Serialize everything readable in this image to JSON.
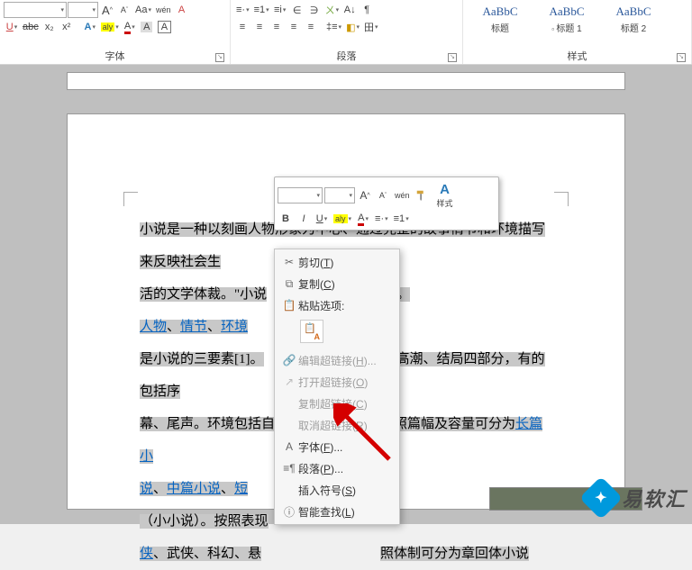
{
  "ribbon": {
    "font": {
      "label": "字体",
      "font_name": "",
      "font_size": "",
      "grow": "A",
      "shrink": "A",
      "change_case": "Aa",
      "phonetic": "wén",
      "clear_fmt": "A",
      "underline": "U",
      "strike": "abc",
      "sub": "x₂",
      "sup": "x²",
      "effects": "A",
      "highlight": "aly",
      "font_color": "A",
      "char_shade": "A",
      "char_border": "A"
    },
    "para": {
      "label": "段落",
      "bullets": "•",
      "numbering": "1",
      "multilevel": "i",
      "dec_indent": "←",
      "inc_indent": "→",
      "sort_cn": "ㄨ",
      "sort": "A↓",
      "show_marks": "¶",
      "align_l": "≡",
      "align_c": "≡",
      "align_r": "≡",
      "justify": "≡",
      "distrib": "≡",
      "line_sp": "↕",
      "shade": "◧",
      "border": "田"
    },
    "styles": {
      "label": "样式",
      "items": [
        {
          "preview": "AaBbC",
          "name": "标题"
        },
        {
          "preview": "AaBbC",
          "name": "标题 1"
        },
        {
          "preview": "AaBbC",
          "name": "标题 2"
        }
      ]
    }
  },
  "mini": {
    "font_name": "",
    "font_size": "",
    "grow": "A",
    "shrink": "A",
    "fmt_painter": "✎",
    "styles_btn": "A",
    "styles_label": "样式",
    "bold": "B",
    "italic": "I",
    "underline": "U",
    "highlight": "aly",
    "font_color": "A",
    "bullets": "•",
    "numbering": "1"
  },
  "menu": {
    "cut": {
      "text": "剪切",
      "key": "T"
    },
    "copy": {
      "text": "复制",
      "key": "C"
    },
    "paste_label": "粘贴选项:",
    "edit_link": {
      "text": "编辑超链接",
      "key": "H",
      "suffix": "..."
    },
    "open_link": {
      "text": "打开超链接",
      "key": "O"
    },
    "copy_link": {
      "text": "复制超链接",
      "key": "C"
    },
    "remove_link": {
      "text": "取消超链接",
      "key": "R"
    },
    "font": {
      "text": "字体",
      "key": "F",
      "suffix": "..."
    },
    "paragraph": {
      "text": "段落",
      "key": "P",
      "suffix": "..."
    },
    "symbol": {
      "text": "插入符号",
      "key": "S"
    },
    "lookup": {
      "text": "智能查找",
      "key": "L"
    }
  },
  "doc": {
    "l1a": "小说是一种以刻画人物形象为中心、通过完整的故事情节和环境描写来反映社会生",
    "l2a": "活的文学体裁。\"小说",
    "l2b": "\"。",
    "link_people": "人物",
    "sep1": "、",
    "link_plot": "情节",
    "sep2": "、",
    "link_env": "环境",
    "l4a": "是小说的三要素[1]。",
    "l4b": "、高潮、结局四部分，有的包括序",
    "l5a": "幕、尾声。环境包括自",
    "l5b": "照篇幅及容量可分为",
    "link_long": "长篇小",
    "link_long2": "说",
    "sep3": "、",
    "link_mid": "中篇小说",
    "sep4": "、",
    "link_short": "短",
    "l7a": "（小小说）。按照表现",
    "link_wx": "侠",
    "sep5a": "、武侠、科幻、悬",
    "l8b": "照体制可分为章回体小说"
  },
  "watermark": {
    "text": "易软汇"
  }
}
